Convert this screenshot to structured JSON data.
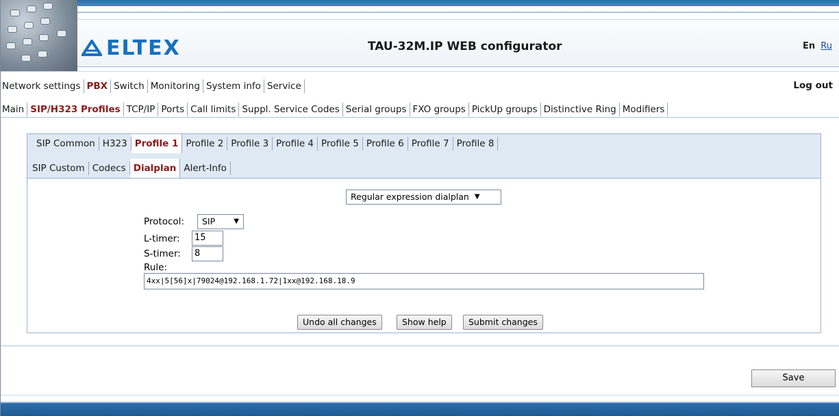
{
  "header": {
    "brand": "ELTEX",
    "title": "TAU-32M.IP WEB configurator",
    "lang_en": "En",
    "lang_ru": "Ru"
  },
  "main_menu": {
    "items": [
      "Network settings",
      "PBX",
      "Switch",
      "Monitoring",
      "System info",
      "Service"
    ],
    "active": "PBX",
    "logout": "Log out"
  },
  "sub_menu": {
    "items": [
      "Main",
      "SIP/H323 Profiles",
      "TCP/IP",
      "Ports",
      "Call limits",
      "Suppl. Service Codes",
      "Serial groups",
      "FXO groups",
      "PickUp groups",
      "Distinctive Ring",
      "Modifiers"
    ],
    "active": "SIP/H323 Profiles"
  },
  "profile_tabs": {
    "items": [
      "SIP Common",
      "H323",
      "Profile 1",
      "Profile 2",
      "Profile 3",
      "Profile 4",
      "Profile 5",
      "Profile 6",
      "Profile 7",
      "Profile 8"
    ],
    "active": "Profile 1"
  },
  "section_tabs": {
    "items": [
      "SIP Custom",
      "Codecs",
      "Dialplan",
      "Alert-Info"
    ],
    "active": "Dialplan"
  },
  "dialplan": {
    "mode": "Regular expression dialplan",
    "protocol_label": "Protocol:",
    "protocol_value": "SIP",
    "l_timer_label": "L-timer:",
    "l_timer_value": "15",
    "s_timer_label": "S-timer:",
    "s_timer_value": "8",
    "rule_label": "Rule:",
    "rule_value": "4xx|5[56]x|79024@192.168.1.72|1xx@192.168.18.9"
  },
  "buttons": {
    "undo": "Undo all changes",
    "help": "Show help",
    "submit": "Submit changes",
    "save": "Save"
  }
}
